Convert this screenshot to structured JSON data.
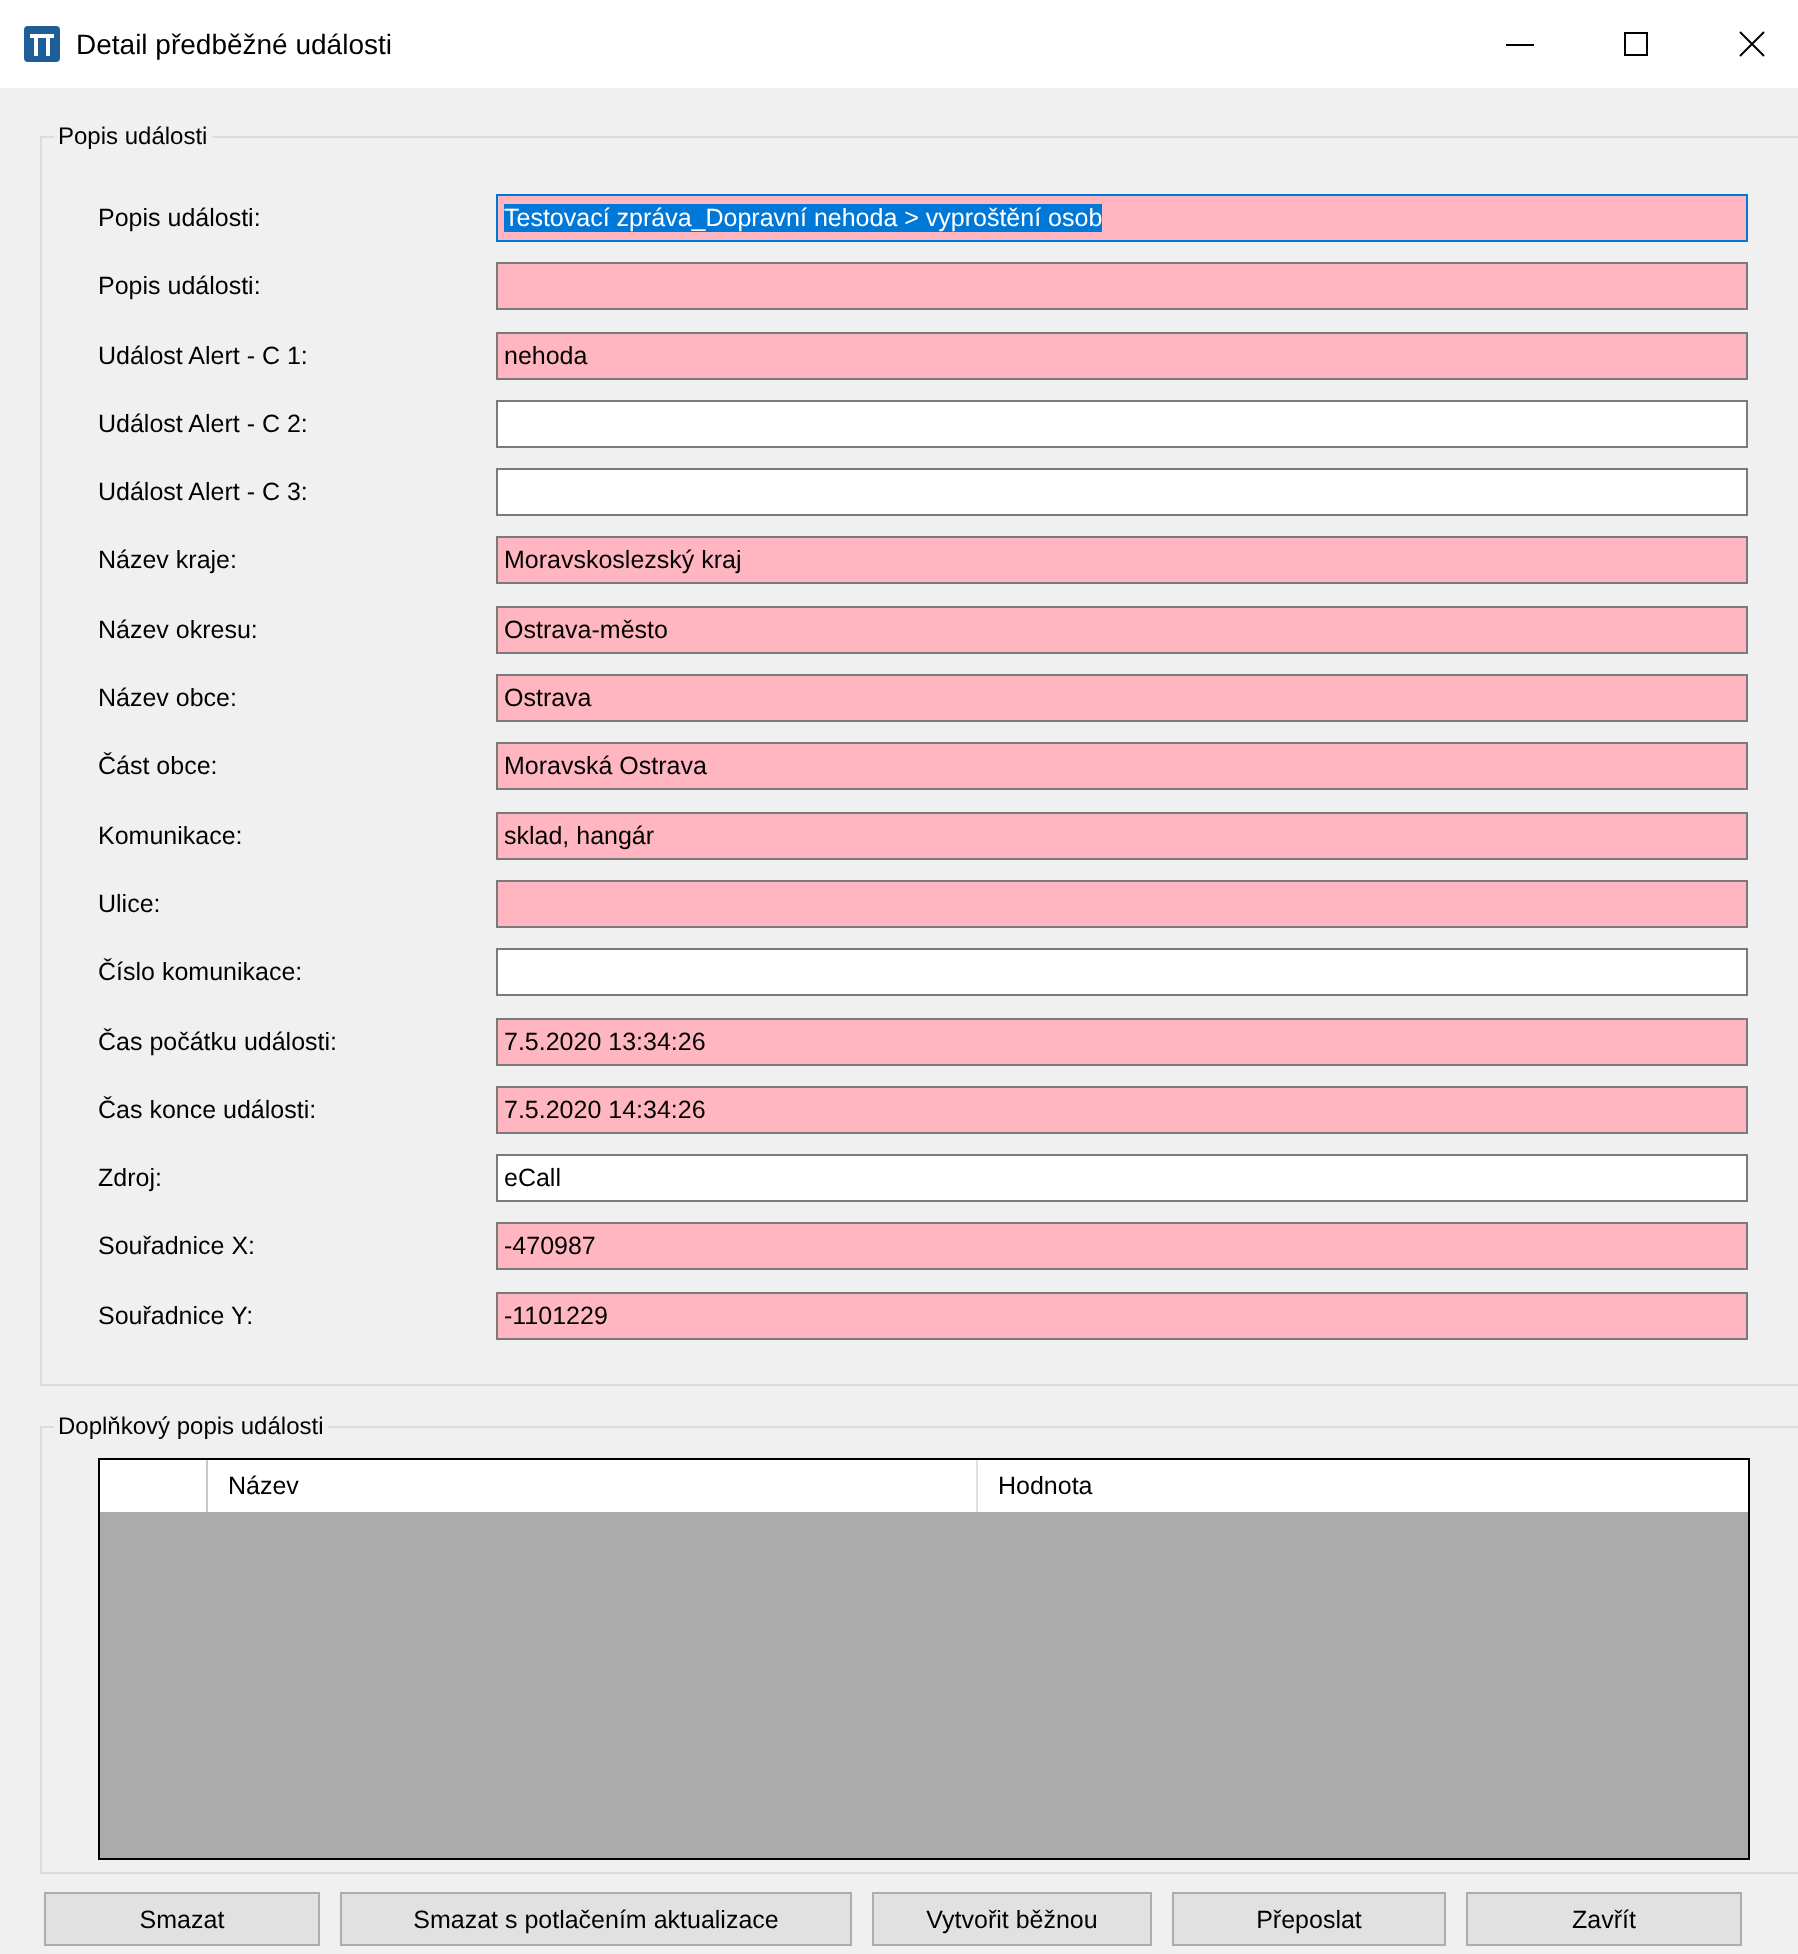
{
  "window": {
    "title": "Detail předběžné události"
  },
  "event_group": {
    "title": "Popis události",
    "fields": [
      {
        "label": "Popis události:",
        "value": "Testovací zpráva_Dopravní nehoda > vyproštění osob",
        "highlighted": true,
        "focused": true
      },
      {
        "label": "Popis události:",
        "highlighted": true,
        "focused": false
      },
      {
        "label": "Událost Alert - C 1:",
        "value": "nehoda",
        "highlighted": true,
        "focused": false
      },
      {
        "label": "Událost Alert - C 2:",
        "highlighted": false,
        "focused": false
      },
      {
        "label": "Událost Alert - C 3:",
        "highlighted": false,
        "focused": false
      },
      {
        "label": "Název kraje:",
        "value": "Moravskoslezský kraj",
        "highlighted": true,
        "focused": false
      },
      {
        "label": "Název okresu:",
        "value": "Ostrava-město",
        "highlighted": true,
        "focused": false
      },
      {
        "label": "Název obce:",
        "value": "Ostrava",
        "highlighted": true,
        "focused": false
      },
      {
        "label": "Část obce:",
        "value": "Moravská Ostrava",
        "highlighted": true,
        "focused": false
      },
      {
        "label": "Komunikace:",
        "value": "sklad, hangár",
        "highlighted": true,
        "focused": false
      },
      {
        "label": "Ulice:",
        "highlighted": true,
        "focused": false
      },
      {
        "label": "Číslo komunikace:",
        "highlighted": false,
        "focused": false
      },
      {
        "label": "Čas počátku události:",
        "value": "7.5.2020 13:34:26",
        "highlighted": true,
        "focused": false
      },
      {
        "label": "Čas konce události:",
        "value": "7.5.2020 14:34:26",
        "highlighted": true,
        "focused": false
      },
      {
        "label": "Zdroj:",
        "value": "eCall",
        "highlighted": false,
        "focused": false
      },
      {
        "label": "Souřadnice X:",
        "value": "-470987",
        "highlighted": true,
        "focused": false
      },
      {
        "label": "Souřadnice Y:",
        "value": "-1101229",
        "highlighted": true,
        "focused": false
      }
    ]
  },
  "extra_group": {
    "title": "Doplňkový popis události",
    "table": {
      "columns": [
        "Název",
        "Hodnota"
      ]
    }
  },
  "buttons": [
    "Smazat",
    "Smazat s potlačením aktualizace",
    "Vytvořit běžnou",
    "Přeposlat",
    "Zavřít"
  ]
}
